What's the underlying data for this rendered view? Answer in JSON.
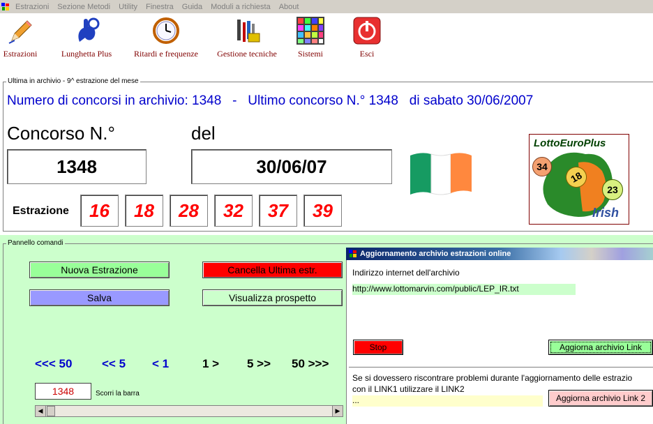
{
  "menu": {
    "items": [
      "Estrazioni",
      "Sezione Metodi",
      "Utility",
      "Finestra",
      "Guida",
      "Moduli a richiesta",
      "About"
    ]
  },
  "toolbar": {
    "estrazioni": "Estrazioni",
    "lunghetta": "Lunghetta Plus",
    "ritardi": "Ritardi e frequenze",
    "gestione": "Gestione tecniche",
    "sistemi": "Sistemi",
    "esci": "Esci"
  },
  "archive": {
    "frame_title": "Ultima in archivio - 9^ estrazione del mese",
    "summary": "Numero di concorsi in archivio: 1348   -   Ultimo concorso N.° 1348   di sabato 30/06/2007",
    "concorso_label": "Concorso N.°",
    "del_label": "del",
    "concorso_value": "1348",
    "date_value": "30/06/07",
    "estrazione_label": "Estrazione",
    "numbers": [
      "16",
      "18",
      "28",
      "32",
      "37",
      "39"
    ],
    "logo": {
      "title": "LottoEuroPlus",
      "balls": [
        "34",
        "18",
        "23"
      ],
      "subtitle": "Irish"
    }
  },
  "panel": {
    "frame_title": "Pannello comandi",
    "nuova": "Nuova Estrazione",
    "cancella": "Cancella Ultima estr.",
    "salva": "Salva",
    "visualizza": "Visualizza prospetto",
    "nav": [
      "<<< 50",
      "<< 5",
      "< 1",
      "1 >",
      "5 >>",
      "50 >>>"
    ],
    "scroll_value": "1348",
    "scroll_label": "Scorri la barra",
    "colors": {
      "bg": "#ccffcc",
      "nuova": "#99ff99",
      "cancella": "#ff0000",
      "salva": "#9999ff",
      "visualizza": "#ccffcc"
    }
  },
  "online": {
    "title": "Aggiornamento archivio estrazioni online",
    "url_label": "Indirizzo internet dell'archivio",
    "url": "http://www.lottomarvin.com/public/LEP_IR.txt",
    "stop": "Stop",
    "aggiorna": "Aggiorna archivio Link",
    "info": "Se si dovessero riscontrare problemi durante l'aggiornamento delle estrazio",
    "info2": "con il LINK1 utilizzare il LINK2",
    "link2_value": "...",
    "aggiorna2": "Aggiorna archivio Link 2"
  }
}
